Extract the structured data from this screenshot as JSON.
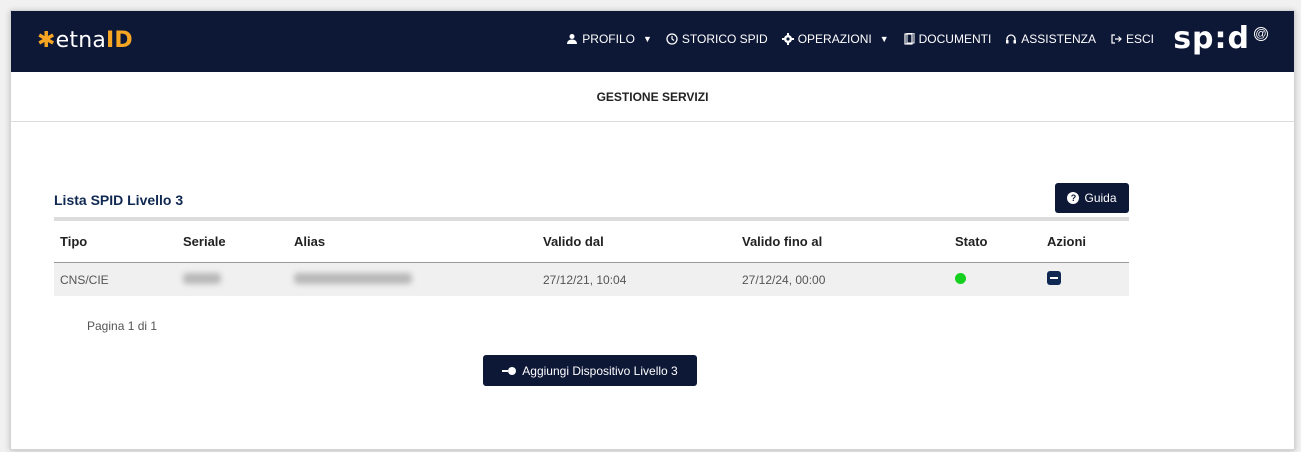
{
  "logo": {
    "mark": "✱",
    "brand": "etna",
    "suffix": "ID"
  },
  "nav": {
    "items": [
      {
        "label": "PROFILO",
        "icon": "user-icon",
        "dropdown": true
      },
      {
        "label": "STORICO SPID",
        "icon": "clock-icon",
        "dropdown": false
      },
      {
        "label": "OPERAZIONI",
        "icon": "gear-icon",
        "dropdown": true
      },
      {
        "label": "DOCUMENTI",
        "icon": "document-icon",
        "dropdown": false
      },
      {
        "label": "ASSISTENZA",
        "icon": "headset-icon",
        "dropdown": false
      },
      {
        "label": "ESCI",
        "icon": "logout-icon",
        "dropdown": false
      }
    ],
    "caret": "▼",
    "spid_logo": "sp:d",
    "spid_badge": "@"
  },
  "subheader": {
    "title": "GESTIONE SERVIZI"
  },
  "section": {
    "title": "Lista SPID Livello 3"
  },
  "guide_button": {
    "label": "Guida",
    "icon_symbol": "?"
  },
  "table": {
    "columns": [
      "Tipo",
      "Seriale",
      "Alias",
      "Valido dal",
      "Valido fino al",
      "Stato",
      "Azioni"
    ],
    "rows": [
      {
        "tipo": "CNS/CIE",
        "valido_dal": "27/12/21, 10:04",
        "valido_fino": "27/12/24, 00:00",
        "stato": "active",
        "stato_color": "#15d01f"
      }
    ]
  },
  "pagination": {
    "text": "Pagina 1 di 1"
  },
  "add_button": {
    "label": "Aggiungi Dispositivo Livello 3"
  },
  "colors": {
    "navbar": "#0d1736",
    "accent": "#f6a623",
    "title": "#0f2952"
  }
}
